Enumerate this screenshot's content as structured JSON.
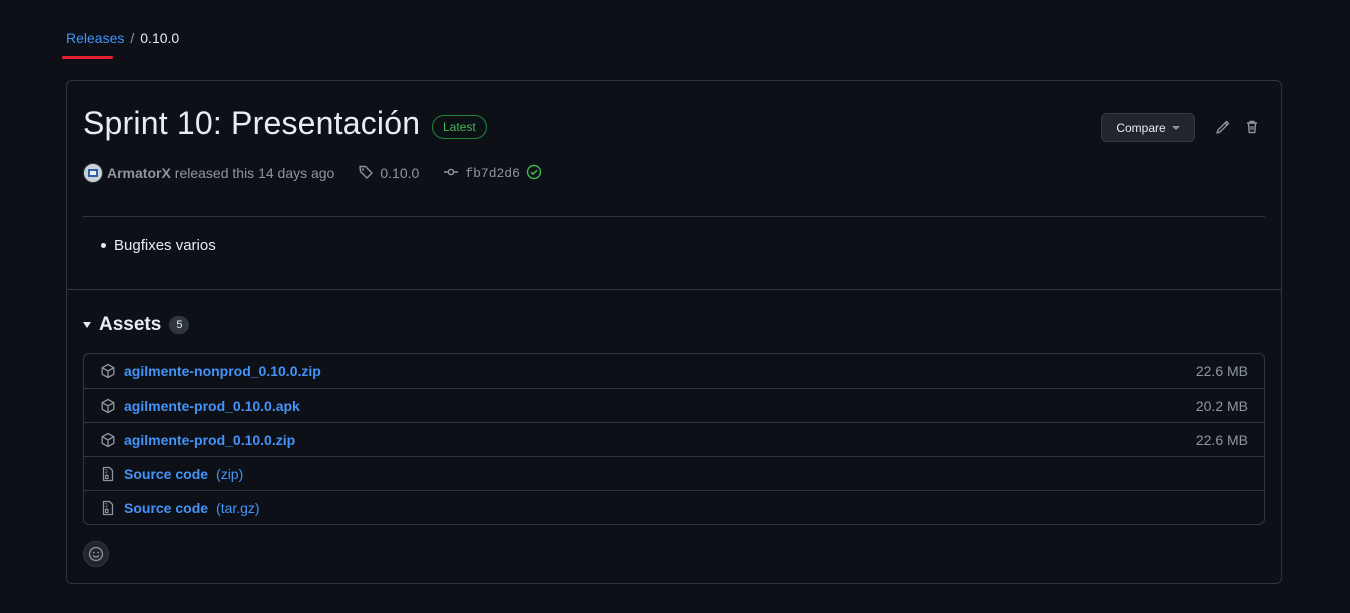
{
  "breadcrumb": {
    "releases_label": "Releases",
    "separator": "/",
    "current": "0.10.0"
  },
  "release": {
    "title": "Sprint 10: Presentación",
    "badge": "Latest",
    "compare_label": "Compare",
    "author": "ArmatorX",
    "released_text": "released this 14 days ago",
    "tag": "0.10.0",
    "commit": "fb7d2d6",
    "notes": [
      "Bugfixes varios"
    ]
  },
  "assets": {
    "heading": "Assets",
    "count": "5",
    "items": [
      {
        "name": "agilmente-nonprod_0.10.0.zip",
        "sub": "",
        "size": "22.6 MB",
        "icon": "package-icon"
      },
      {
        "name": "agilmente-prod_0.10.0.apk",
        "sub": "",
        "size": "20.2 MB",
        "icon": "package-icon"
      },
      {
        "name": "agilmente-prod_0.10.0.zip",
        "sub": "",
        "size": "22.6 MB",
        "icon": "package-icon"
      },
      {
        "name": "Source code",
        "sub": "(zip)",
        "size": "",
        "icon": "file-zip-icon"
      },
      {
        "name": "Source code",
        "sub": "(tar.gz)",
        "size": "",
        "icon": "file-zip-icon"
      }
    ]
  },
  "colors": {
    "background": "#0d1117",
    "link": "#4493f8",
    "success": "#3fb950",
    "border": "#30363d",
    "underline": "#e5212e"
  }
}
